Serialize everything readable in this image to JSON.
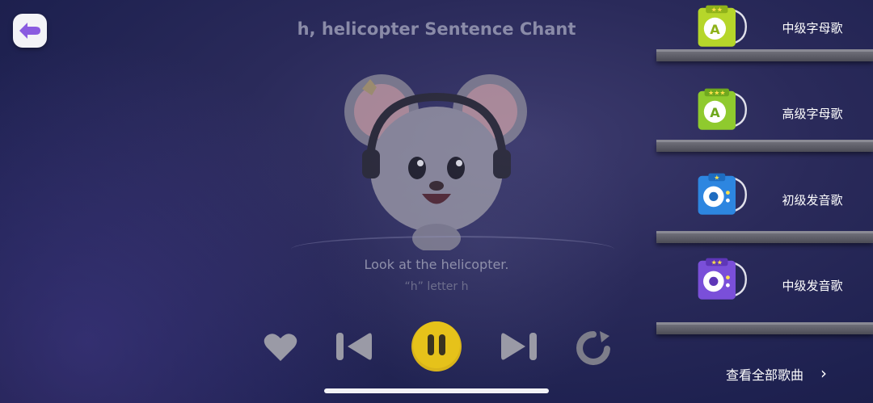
{
  "header": {
    "back_icon": "back-arrow-icon",
    "title": "h, helicopter Sentence Chant"
  },
  "lyrics": {
    "line": "Look at the helicopter.",
    "subline": "“h” letter h"
  },
  "controls": {
    "favorite_icon": "heart-icon",
    "prev_icon": "previous-track-icon",
    "play_pause_icon": "pause-icon",
    "next_icon": "next-track-icon",
    "repeat_icon": "repeat-icon",
    "pause_color": "#e6c21a"
  },
  "playlist": {
    "items": [
      {
        "label": "中级字母歌",
        "stars": 2,
        "color": "#b6d62a",
        "icon": "letter-song-album-icon"
      },
      {
        "label": "高级字母歌",
        "stars": 3,
        "color": "#8fca2e",
        "icon": "letter-song-album-icon"
      },
      {
        "label": "初级发音歌",
        "stars": 1,
        "color": "#2d86e0",
        "icon": "phonics-song-album-icon"
      },
      {
        "label": "中级发音歌",
        "stars": 2,
        "color": "#7a4fd9",
        "icon": "phonics-song-album-icon"
      }
    ],
    "view_all": "查看全部歌曲"
  }
}
